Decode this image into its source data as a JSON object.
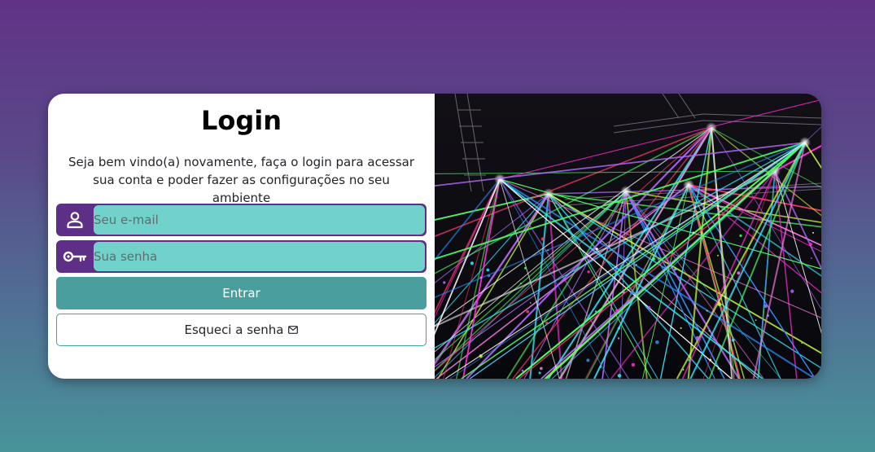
{
  "login": {
    "title": "Login",
    "subtitle": "Seja bem vindo(a) novamente, faça o login para acessar sua conta e poder fazer as configurações no seu ambiente",
    "email_placeholder": "Seu e-mail",
    "email_icon": "person-icon",
    "password_placeholder": "Sua senha",
    "password_icon": "key-icon",
    "submit_label": "Entrar",
    "forgot_label": "Esqueci a senha",
    "forgot_icon": "envelope-icon"
  },
  "hero_image": {
    "description_icon": "laser-lights-image"
  },
  "colors": {
    "accent_purple": "#5d2f87",
    "input_teal": "#71d2cc",
    "button_teal": "#4a9e9d",
    "background_top": "#613286",
    "background_bottom": "#48949a"
  }
}
